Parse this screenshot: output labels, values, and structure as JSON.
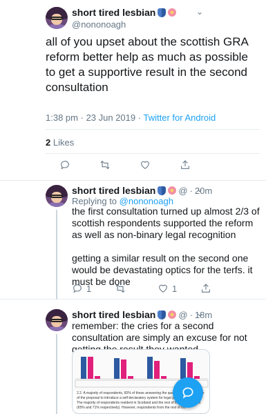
{
  "main_tweet": {
    "display_name": "short tired lesbian",
    "handle": "@nononoagh",
    "text": "all of you upset about the scottish GRA reform better help as much as possible to get a supportive result in the second consultation",
    "time": "1:38 pm",
    "date": "23 Jun 2019",
    "source": "Twitter for Android",
    "likes_count": "2",
    "likes_label": "Likes"
  },
  "replies": [
    {
      "display_name": "short tired lesbian",
      "handle_short": "@",
      "time": "20m",
      "replying_prefix": "Replying to",
      "replying_handle": "@nononoagh",
      "text": "the first consultation turned up almost 2/3 of scottish respondents supported the reform as well as non-binary legal recognition\n\ngetting a similar result on the second one would be devastating optics for the terfs. it must be done",
      "reply_count": "1",
      "like_count": "1"
    },
    {
      "display_name": "short tired lesbian",
      "handle_short": "@",
      "time": "18m",
      "text": "remember: the cries for a second consultation are simply an excuse for not getting the result they wanted",
      "embed_text": "2.2. A majority of respondents, 60% of those answering the question, were in favour of the proposal to introduce a self-declaratory system for legal gender recognition. The majority of respondents resident in Scotland and the rest of the world agreed (65% and 71% respectively). However, respondents from the rest of the"
    }
  ],
  "colors": {
    "accent": "#1da1f2",
    "secondary_text": "#657786",
    "chart_pink": "#e0207a",
    "chart_blue": "#2d5aa0"
  }
}
